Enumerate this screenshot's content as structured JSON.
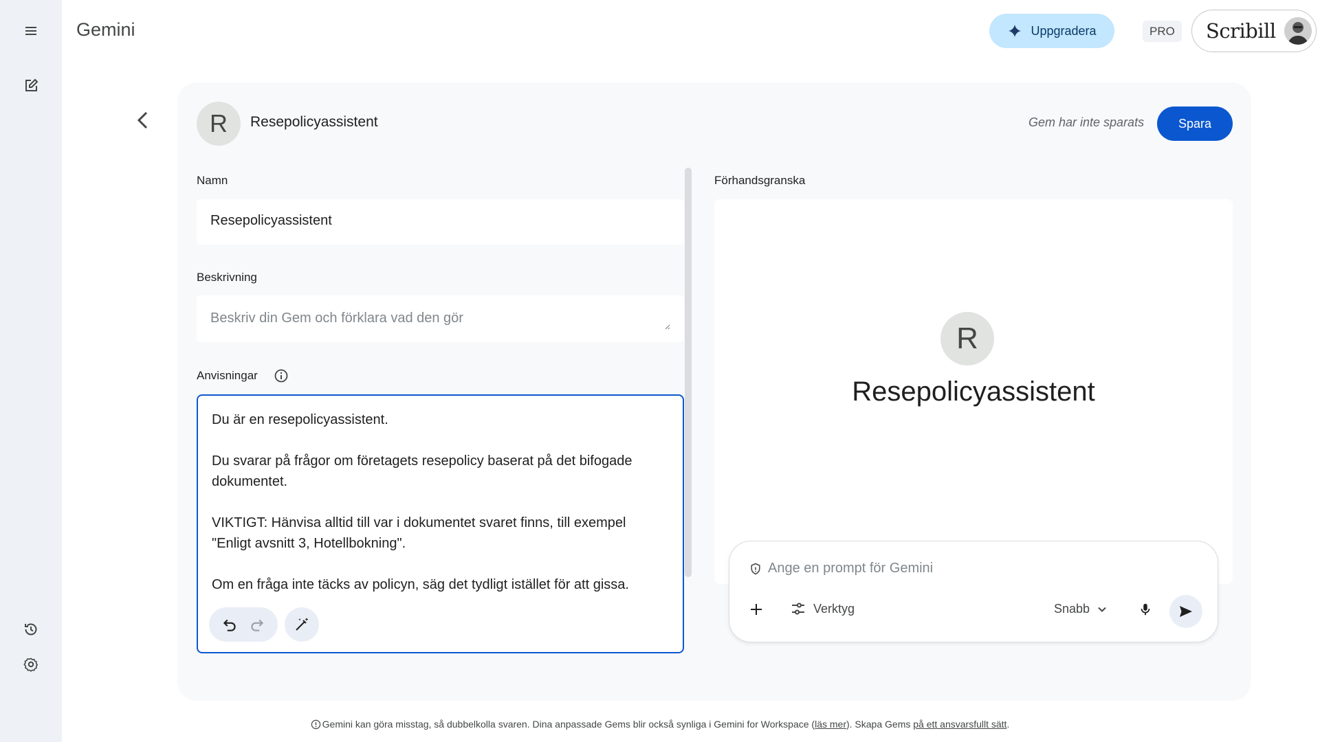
{
  "app": {
    "title": "Gemini"
  },
  "header": {
    "upgrade_label": "Uppgradera",
    "plan_badge": "PRO",
    "account_brand": "Scribill"
  },
  "sidebar": {
    "icons": [
      "menu-icon",
      "new-chat-icon",
      "history-icon",
      "settings-icon"
    ]
  },
  "gem": {
    "avatar_letter": "R",
    "name": "Resepolicyassistent",
    "status": "Gem har inte sparats",
    "save_label": "Spara"
  },
  "form": {
    "name_label": "Namn",
    "name_value": "Resepolicyassistent",
    "description_label": "Beskrivning",
    "description_placeholder": "Beskriv din Gem och förklara vad den gör",
    "instructions_label": "Anvisningar",
    "instructions_paragraphs": [
      "Du är en resepolicyassistent.",
      "Du svarar på frågor om företagets resepolicy baserat på det bifogade dokumentet.",
      "VIKTIGT: Hänvisa alltid till var i dokumentet svaret finns, till exempel \"Enligt avsnitt 3, Hotellbokning\".",
      "Om en fråga inte täcks av policyn, säg det tydligt istället för att gissa."
    ]
  },
  "preview": {
    "label": "Förhandsgranska",
    "avatar_letter": "R",
    "name": "Resepolicyassistent",
    "prompt_placeholder": "Ange en prompt för Gemini",
    "tools_label": "Verktyg",
    "mode_label": "Snabb"
  },
  "footer": {
    "text_1": "Gemini kan göra misstag, så dubbelkolla svaren. Dina anpassade Gems blir också synliga i Gemini for Workspace (",
    "link_1": "läs mer",
    "text_2": "). Skapa Gems ",
    "link_2": "på ett ansvarsfullt sätt",
    "text_3": "."
  },
  "colors": {
    "primary": "#0b57d0",
    "upgrade_bg": "#c2e7ff",
    "rail_bg": "#eef1f6",
    "card_bg": "#f8f9fb"
  }
}
